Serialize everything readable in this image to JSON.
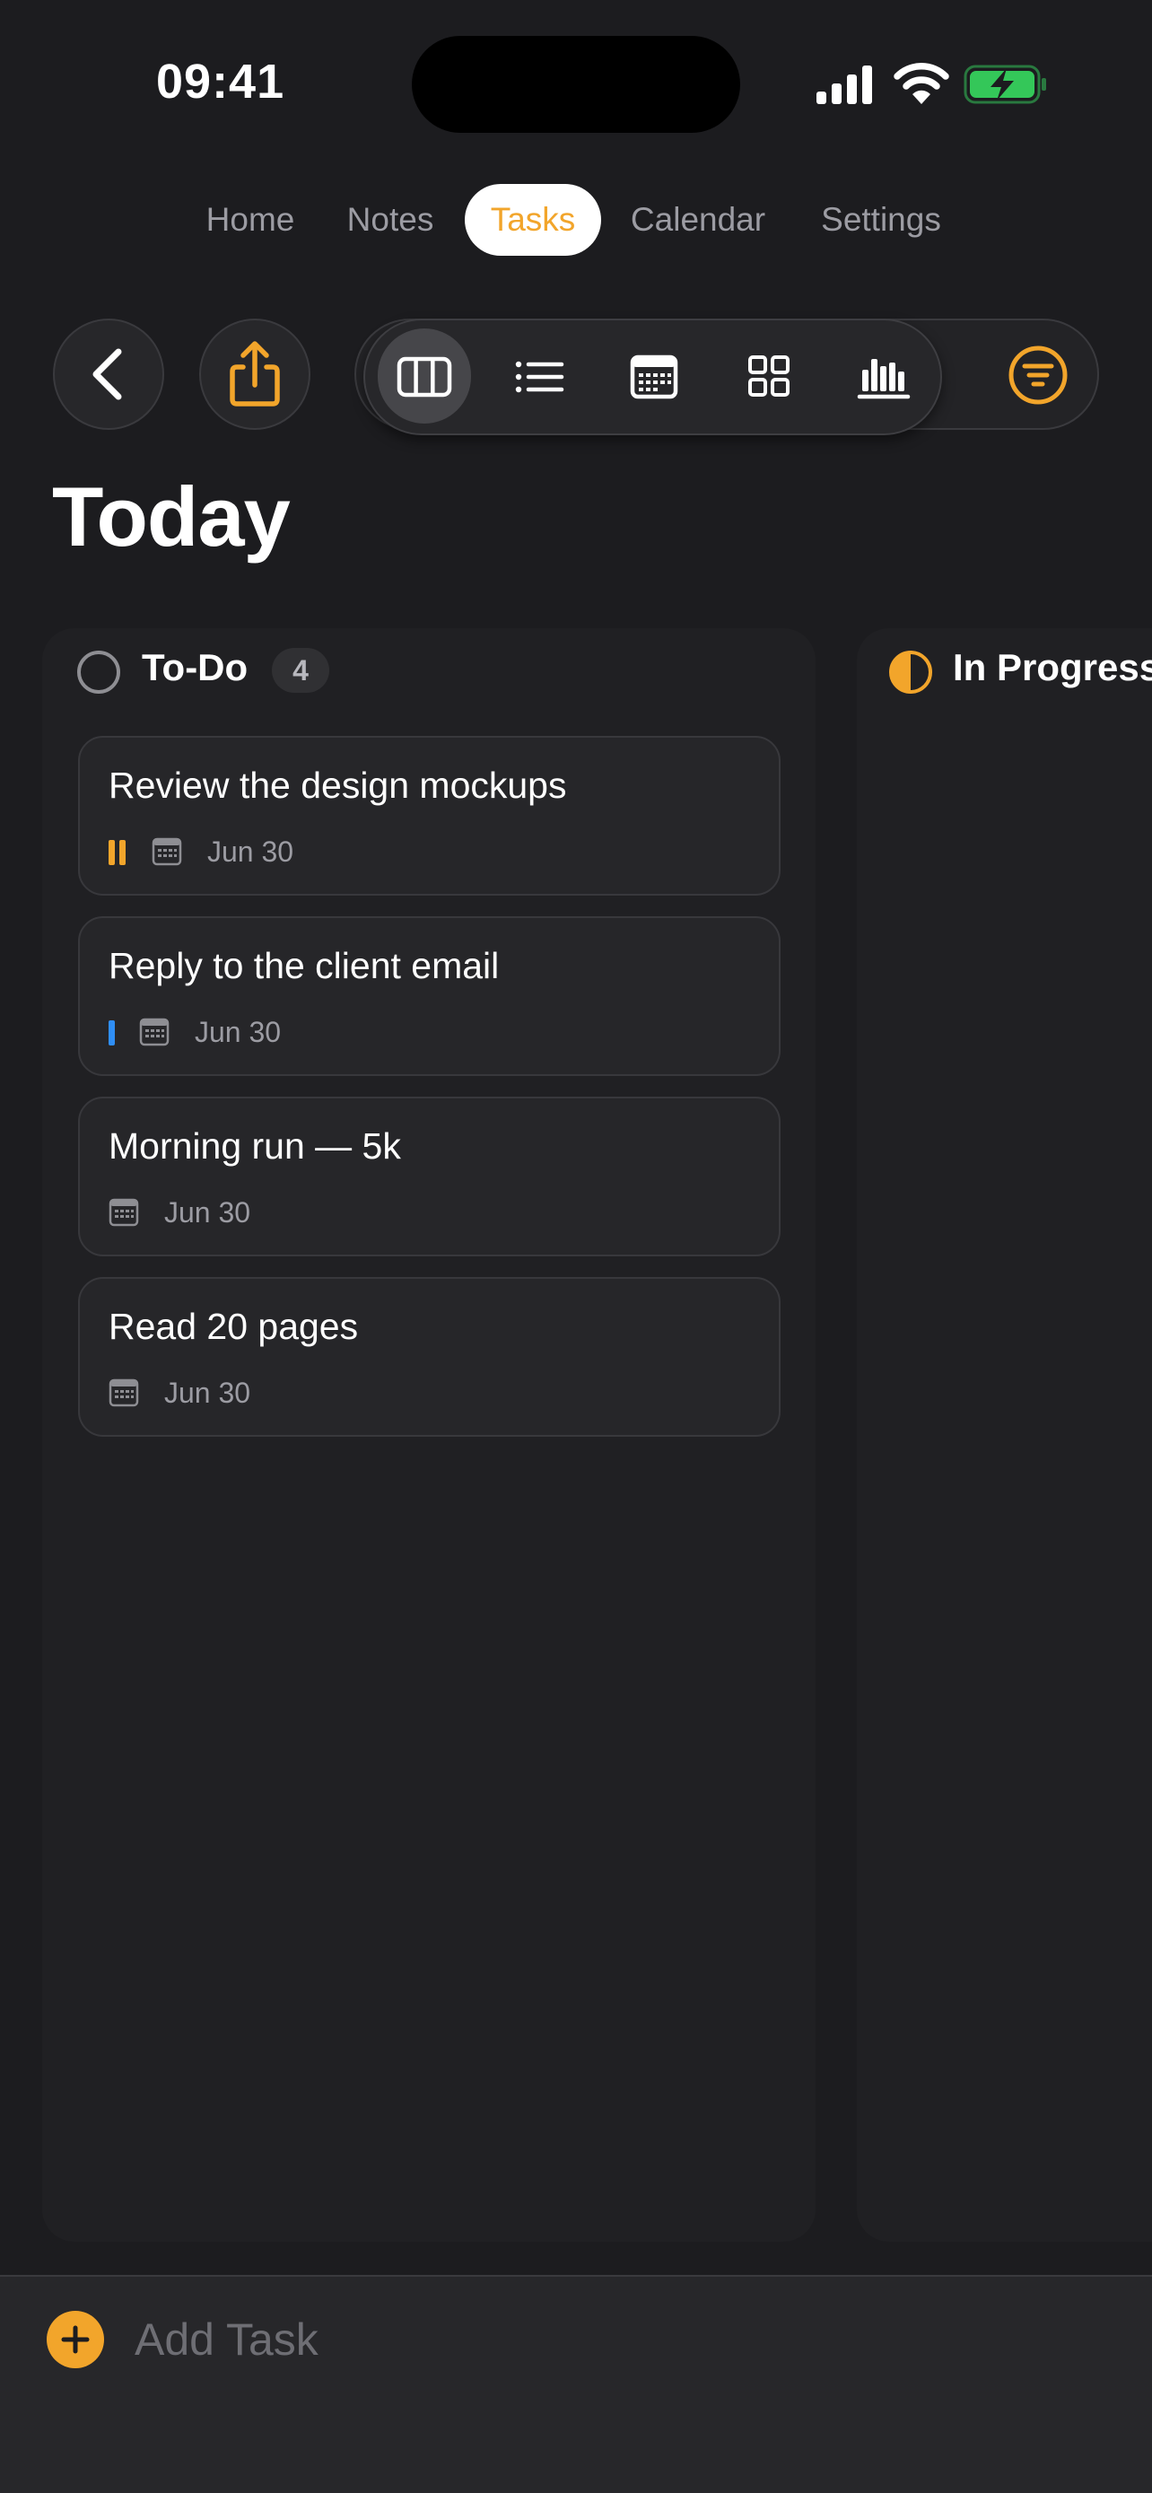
{
  "status_bar": {
    "time": "09:41",
    "icons": [
      "cellular-signal-icon",
      "wifi-icon",
      "battery-charging-icon"
    ]
  },
  "tabs": [
    {
      "label": "Home",
      "active": false
    },
    {
      "label": "Notes",
      "active": false
    },
    {
      "label": "Tasks",
      "active": true
    },
    {
      "label": "Calendar",
      "active": false
    },
    {
      "label": "Settings",
      "active": false
    }
  ],
  "toolbar": {
    "back_icon": "chevron-left-icon",
    "share_icon": "share-icon",
    "views": [
      {
        "name": "board-view",
        "icon": "columns-icon",
        "selected": true
      },
      {
        "name": "list-view",
        "icon": "list-icon",
        "selected": false
      },
      {
        "name": "calendar-view",
        "icon": "calendar-icon",
        "selected": false
      },
      {
        "name": "grid-view",
        "icon": "grid-icon",
        "selected": false
      },
      {
        "name": "chart-view",
        "icon": "bar-chart-icon",
        "selected": false
      }
    ],
    "filter_icon": "filter-icon"
  },
  "page": {
    "title": "Today"
  },
  "columns": [
    {
      "title": "To-Do",
      "count": "4",
      "status_icon": "empty-circle-icon",
      "tasks": [
        {
          "title": "Review the design mockups",
          "priority": "high",
          "date": "Jun 30"
        },
        {
          "title": "Reply to the client email",
          "priority": "low",
          "date": "Jun 30"
        },
        {
          "title": "Morning run — 5k",
          "priority": "none",
          "date": "Jun 30"
        },
        {
          "title": "Read 20 pages",
          "priority": "none",
          "date": "Jun 30"
        }
      ]
    },
    {
      "title": "In Progress",
      "status_icon": "half-circle-icon",
      "tasks": []
    }
  ],
  "bottom_bar": {
    "placeholder": "Add Task",
    "value": ""
  },
  "colors": {
    "accent": "#f2a52b",
    "background": "#1c1c1f",
    "card": "#262629",
    "priority_high": "#f2a52b",
    "priority_low": "#2f8ef5",
    "battery": "#34c759"
  }
}
